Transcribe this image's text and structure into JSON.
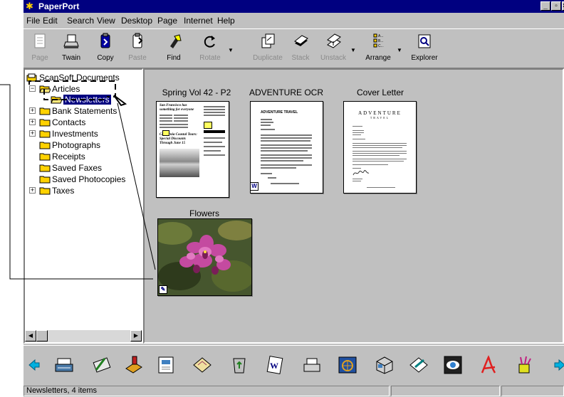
{
  "app": {
    "title": "PaperPort"
  },
  "window_controls": {
    "minimize": "_",
    "maximize": "▫",
    "close": "×"
  },
  "menu": [
    "File",
    "Edit",
    "Search",
    "View",
    "Desktop",
    "Page",
    "Internet",
    "Help"
  ],
  "toolbar": {
    "page": "Page",
    "twain": "Twain",
    "copy": "Copy",
    "paste": "Paste",
    "find": "Find",
    "rotate": "Rotate",
    "duplicate": "Duplicate",
    "stack": "Stack",
    "unstack": "Unstack",
    "arrange": "Arrange",
    "explorer": "Explorer"
  },
  "tree": {
    "root": "ScanSoft Documents",
    "articles": "Articles",
    "newsletters": "Newsletters",
    "bank": "Bank Statements",
    "contacts": "Contacts",
    "investments": "Investments",
    "photographs": "Photographs",
    "receipts": "Receipts",
    "saved_faxes": "Saved Faxes",
    "saved_photocopies": "Saved Photocopies",
    "taxes": "Taxes"
  },
  "documents": [
    {
      "title": "Spring Vol 42 - P2",
      "headline": "San Francisco has something for everyone",
      "subhead": "California Coastal Tours: Special Discounts Through June 15"
    },
    {
      "title": "ADVENTURE OCR",
      "heading": "ADVENTURE TRAVEL"
    },
    {
      "title": "Cover Letter",
      "heading": "ADVENTURE",
      "subheading": "TRAVEL"
    },
    {
      "title": "Flowers"
    }
  ],
  "link_icons": [
    "scroll-left-arrow-icon",
    "typewriter-icon",
    "pen-writing-icon",
    "fax-stamp-icon",
    "document-viewer-icon",
    "email-envelope-icon",
    "recycle-bin-icon",
    "word-document-icon",
    "printer-icon",
    "photo-editor-icon",
    "3d-cube-icon",
    "email-send-icon",
    "eye-viewer-icon",
    "acrobat-pdf-icon",
    "paint-brush-icon",
    "scroll-right-arrow-icon"
  ],
  "status": {
    "text": "Newsletters, 4 items"
  },
  "colors": {
    "titlebar": "#000080",
    "face": "#c0c0c0",
    "selection": "#000080",
    "folder": "#ffd200"
  }
}
